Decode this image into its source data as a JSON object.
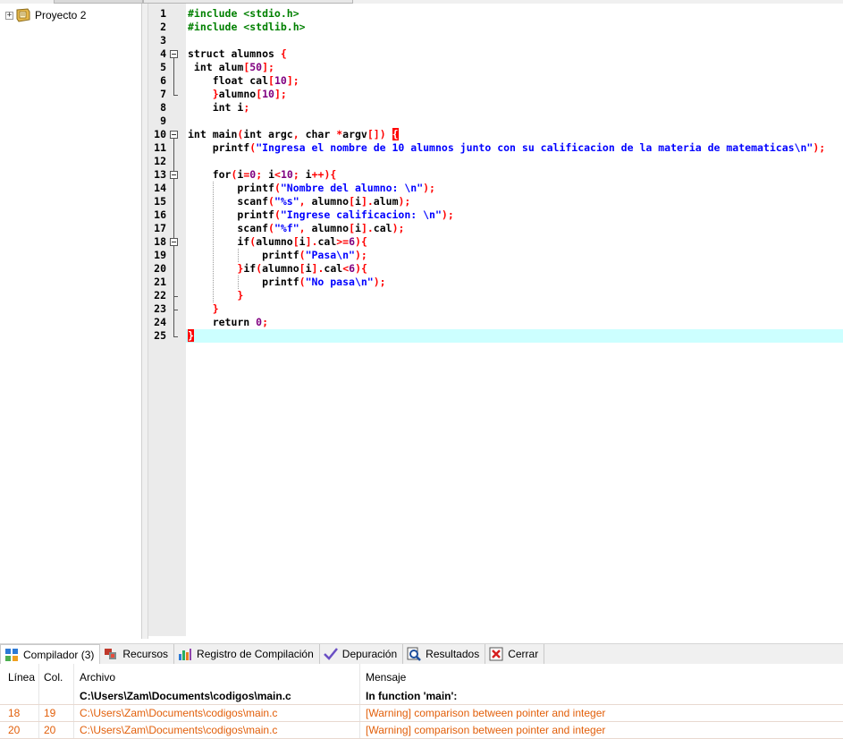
{
  "project": {
    "label": "Proyecto 2",
    "expander": "+"
  },
  "editor": {
    "lines": [
      {
        "n": "1",
        "html": "<span class='pp'>#include &lt;stdio.h&gt;</span>"
      },
      {
        "n": "2",
        "html": "<span class='pp'>#include &lt;stdlib.h&gt;</span>"
      },
      {
        "n": "3",
        "html": ""
      },
      {
        "n": "4",
        "html": "struct alumnos <span class='brk'>{</span>"
      },
      {
        "n": "5",
        "html": " int alum<span class='sym'>[</span><span class='num'>50</span><span class='sym'>];</span>"
      },
      {
        "n": "6",
        "html": "    float cal<span class='sym'>[</span><span class='num'>10</span><span class='sym'>];</span>"
      },
      {
        "n": "7",
        "html": "    <span class='brk'>}</span>alumno<span class='sym'>[</span><span class='num'>10</span><span class='sym'>];</span>"
      },
      {
        "n": "8",
        "html": "    int i<span class='sym'>;</span>"
      },
      {
        "n": "9",
        "html": ""
      },
      {
        "n": "10",
        "html": "int main<span class='sym'>(</span>int argc<span class='sym'>,</span> char <span class='sym'>*</span>argv<span class='sym'>[])</span> <span class='brk-hl'>{</span>"
      },
      {
        "n": "11",
        "html": "    printf<span class='sym'>(</span><span class='str'>\"Ingresa el nombre de 10 alumnos junto con su calificacion de la materia de matematicas\\n\"</span><span class='sym'>);</span>"
      },
      {
        "n": "12",
        "html": ""
      },
      {
        "n": "13",
        "html": "    for<span class='sym'>(</span>i<span class='sym'>=</span><span class='num'>0</span><span class='sym'>;</span> i<span class='sym'>&lt;</span><span class='num'>10</span><span class='sym'>;</span> i<span class='sym'>++){</span>"
      },
      {
        "n": "14",
        "html": "        printf<span class='sym'>(</span><span class='str'>\"Nombre del alumno: \\n\"</span><span class='sym'>);</span>"
      },
      {
        "n": "15",
        "html": "        scanf<span class='sym'>(</span><span class='str'>\"%s\"</span><span class='sym'>,</span> alumno<span class='sym'>[</span>i<span class='sym'>].</span>alum<span class='sym'>);</span>"
      },
      {
        "n": "16",
        "html": "        printf<span class='sym'>(</span><span class='str'>\"Ingrese calificacion: \\n\"</span><span class='sym'>);</span>"
      },
      {
        "n": "17",
        "html": "        scanf<span class='sym'>(</span><span class='str'>\"%f\"</span><span class='sym'>,</span> alumno<span class='sym'>[</span>i<span class='sym'>].</span>cal<span class='sym'>);</span>"
      },
      {
        "n": "18",
        "html": "        if<span class='sym'>(</span>alumno<span class='sym'>[</span>i<span class='sym'>].</span>cal<span class='sym'>&gt;=</span><span class='num'>6</span><span class='sym'>){</span>"
      },
      {
        "n": "19",
        "html": "            printf<span class='sym'>(</span><span class='str'>\"Pasa\\n\"</span><span class='sym'>);</span>"
      },
      {
        "n": "20",
        "html": "        <span class='sym'>}</span>if<span class='sym'>(</span>alumno<span class='sym'>[</span>i<span class='sym'>].</span>cal<span class='sym'>&lt;</span><span class='num'>6</span><span class='sym'>){</span>"
      },
      {
        "n": "21",
        "html": "            printf<span class='sym'>(</span><span class='str'>\"No pasa\\n\"</span><span class='sym'>);</span>"
      },
      {
        "n": "22",
        "html": "        <span class='sym'>}</span>"
      },
      {
        "n": "23",
        "html": "    <span class='sym'>}</span>"
      },
      {
        "n": "24",
        "html": "    return <span class='num'>0</span><span class='sym'>;</span>"
      },
      {
        "n": "25",
        "html": "<span class='brk-hl'>}</span>"
      }
    ],
    "active_line": 25
  },
  "tabs": [
    {
      "label": "Compilador (3)",
      "icon": "compiler-icon",
      "selected": true
    },
    {
      "label": "Recursos",
      "icon": "resources-icon",
      "selected": false
    },
    {
      "label": "Registro de Compilación",
      "icon": "compile-log-icon",
      "selected": false
    },
    {
      "label": "Depuración",
      "icon": "debug-icon",
      "selected": false
    },
    {
      "label": "Resultados",
      "icon": "results-icon",
      "selected": false
    },
    {
      "label": "Cerrar",
      "icon": "close-icon",
      "selected": false
    }
  ],
  "results": {
    "headers": {
      "line": "Línea",
      "col": "Col.",
      "file": "Archivo",
      "message": "Mensaje"
    },
    "rows": [
      {
        "line": "",
        "col": "",
        "file": "C:\\Users\\Zam\\Documents\\codigos\\main.c",
        "message": "In function 'main':",
        "kind": "bold"
      },
      {
        "line": "18",
        "col": "19",
        "file": "C:\\Users\\Zam\\Documents\\codigos\\main.c",
        "message": "[Warning] comparison between pointer and integer",
        "kind": "warn"
      },
      {
        "line": "20",
        "col": "20",
        "file": "C:\\Users\\Zam\\Documents\\codigos\\main.c",
        "message": "[Warning] comparison between pointer and integer",
        "kind": "warn"
      }
    ]
  },
  "colors": {
    "warning": "#e25f0a",
    "active_line": "#ccffff",
    "brace_highlight": "#ff0000",
    "preprocessor": "#008000",
    "string": "#0000ff",
    "number": "#800080",
    "symbol": "#ff0000"
  }
}
